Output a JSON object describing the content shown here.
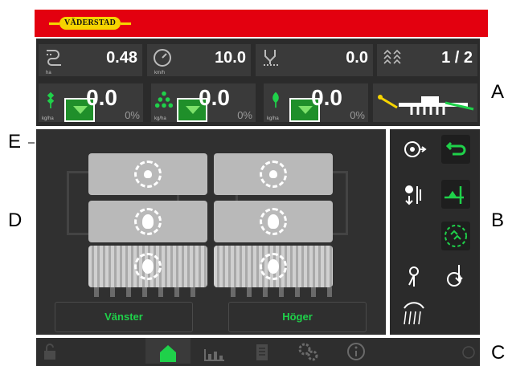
{
  "brand": {
    "logo_text": "VÄDERSTAD"
  },
  "status_row": [
    {
      "icon": "area-counter-icon",
      "unit": "ha",
      "value": "0.48"
    },
    {
      "icon": "speedometer-icon",
      "unit": "km/h",
      "value": "10.0"
    },
    {
      "icon": "seed-drill-counter-icon",
      "unit": "",
      "value": "0.0"
    },
    {
      "icon": "tramline-icon",
      "unit": "",
      "value": "1 / 2"
    }
  ],
  "rate_row": [
    {
      "icon": "wheat-seed-icon",
      "unit": "kg/ha",
      "value": "0.0",
      "percent": "0%"
    },
    {
      "icon": "fertilizer-icon",
      "unit": "kg/ha",
      "value": "0.0",
      "percent": "0%"
    },
    {
      "icon": "sprout-icon",
      "unit": "kg/ha",
      "value": "0.0",
      "percent": "0%"
    }
  ],
  "hopper_buttons": {
    "left": "Vänster",
    "right": "Höger"
  },
  "callouts": {
    "a": "A",
    "b": "B",
    "c": "C",
    "d": "D",
    "e": "E"
  },
  "colors": {
    "header_red": "#e3000f",
    "logo_yellow": "#f6d400",
    "accent_green": "#1fd14a",
    "panel_dark": "#2b2b2b"
  }
}
